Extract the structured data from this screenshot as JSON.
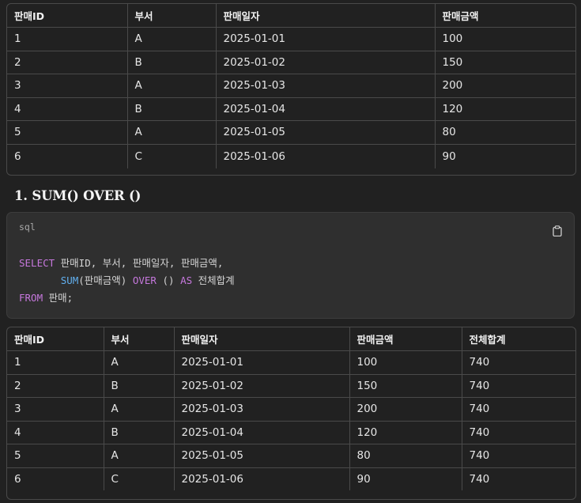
{
  "table1": {
    "headers": [
      "판매ID",
      "부서",
      "판매일자",
      "판매금액"
    ],
    "rows": [
      [
        "1",
        "A",
        "2025-01-01",
        "100"
      ],
      [
        "2",
        "B",
        "2025-01-02",
        "150"
      ],
      [
        "3",
        "A",
        "2025-01-03",
        "200"
      ],
      [
        "4",
        "B",
        "2025-01-04",
        "120"
      ],
      [
        "5",
        "A",
        "2025-01-05",
        "80"
      ],
      [
        "6",
        "C",
        "2025-01-06",
        "90"
      ]
    ]
  },
  "section": {
    "heading": "1. SUM() OVER ()"
  },
  "code": {
    "language": "sql",
    "line1": {
      "kw": "SELECT",
      "rest": " 판매ID, 부서, 판매일자, 판매금액,"
    },
    "line2": {
      "indent": "       ",
      "fn": "SUM",
      "arg": "(판매금액) ",
      "kw1": "OVER",
      "mid": " () ",
      "kw2": "AS",
      "rest": " 전체합계"
    },
    "line3": {
      "kw": "FROM",
      "rest": " 판매;"
    },
    "copy_icon": "clipboard-icon"
  },
  "table2": {
    "headers": [
      "판매ID",
      "부서",
      "판매일자",
      "판매금액",
      "전체합계"
    ],
    "rows": [
      [
        "1",
        "A",
        "2025-01-01",
        "100",
        "740"
      ],
      [
        "2",
        "B",
        "2025-01-02",
        "150",
        "740"
      ],
      [
        "3",
        "A",
        "2025-01-03",
        "200",
        "740"
      ],
      [
        "4",
        "B",
        "2025-01-04",
        "120",
        "740"
      ],
      [
        "5",
        "A",
        "2025-01-05",
        "80",
        "740"
      ],
      [
        "6",
        "C",
        "2025-01-06",
        "90",
        "740"
      ]
    ]
  }
}
